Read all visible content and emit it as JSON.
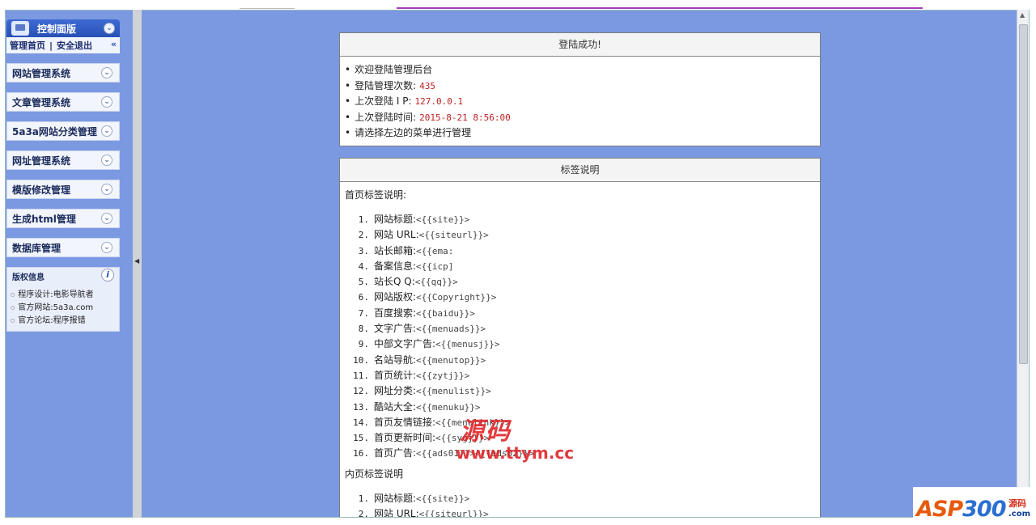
{
  "sidebar": {
    "panel_title": "控制面版",
    "home_link": "管理首页",
    "separator": "|",
    "logout_link": "安全退出",
    "collapse_glyph": "«",
    "menu_items": [
      {
        "label": "网站管理系统"
      },
      {
        "label": "文章管理系统"
      },
      {
        "label": "5a3a网站分类管理"
      },
      {
        "label": "网址管理系统"
      },
      {
        "label": "模版修改管理"
      },
      {
        "label": "生成html管理"
      },
      {
        "label": "数据库管理"
      }
    ],
    "copyright": {
      "title": "版权信息",
      "items": [
        "程序设计:电影导航者",
        "官方网站:5a3a.com",
        "官方论坛:程序报错"
      ]
    }
  },
  "login_box": {
    "title": "登陆成功!",
    "items": [
      {
        "label": "欢迎登陆管理后台",
        "value": ""
      },
      {
        "label": "登陆管理次数:",
        "value": "435"
      },
      {
        "label": "上次登陆 I P:",
        "value": "127.0.0.1"
      },
      {
        "label": "上次登陆时间:",
        "value": "2015-8-21 8:56:00"
      },
      {
        "label": "请选择左边的菜单进行管理",
        "value": ""
      }
    ]
  },
  "tags_box": {
    "title": "标签说明",
    "home_title": "首页标签说明:",
    "home_tags": [
      {
        "num": "1.",
        "label": "网站标题:",
        "code": "<{{site}}>"
      },
      {
        "num": "2.",
        "label": "网站 URL:",
        "code": "<{{siteurl}}>"
      },
      {
        "num": "3.",
        "label": "站长邮箱:",
        "code": "<{{ema:"
      },
      {
        "num": "4.",
        "label": "备案信息:",
        "code": "<{{icp]"
      },
      {
        "num": "5.",
        "label": "站长Q Q:",
        "code": "<{{qq}}>"
      },
      {
        "num": "6.",
        "label": "网站版权:",
        "code": "<{{Copyright}}>"
      },
      {
        "num": "7.",
        "label": "百度搜索:",
        "code": "<{{baidu}}>"
      },
      {
        "num": "8.",
        "label": "文字广告:",
        "code": "<{{menuads}}>"
      },
      {
        "num": "9.",
        "label": "中部文字广告:",
        "code": "<{{menusj}}>"
      },
      {
        "num": "10.",
        "label": "名站导航:",
        "code": "<{{menutop}}>"
      },
      {
        "num": "11.",
        "label": "首页统计:",
        "code": "<{{zytj}}>"
      },
      {
        "num": "12.",
        "label": "网址分类:",
        "code": "<{{menulist}}>"
      },
      {
        "num": "13.",
        "label": "酷站大全:",
        "code": "<{{menuku}}>"
      },
      {
        "num": "14.",
        "label": "首页友情链接:",
        "code": "<{{menulink}}>"
      },
      {
        "num": "15.",
        "label": "首页更新时间:",
        "code": "<{{sygj}}>"
      },
      {
        "num": "16.",
        "label": "首页广告:",
        "code": "<{{ads01}}><{{ads02}}>"
      }
    ],
    "inner_title": "内页标签说明",
    "inner_tags": [
      {
        "num": "1.",
        "label": "网站标题:",
        "code": "<{{site}}>"
      },
      {
        "num": "2.",
        "label": "网站 URL:",
        "code": "<{{siteurl}}>"
      }
    ]
  },
  "watermark": {
    "line1": "源码",
    "line2": "www.ttym.cc"
  },
  "corner_logo": {
    "asp": "ASP",
    "num": "300",
    "cn": "源码",
    "com": ".com"
  },
  "colors": {
    "frame_bg": "#7b99e1",
    "accent_red": "#c02020",
    "purple_line": "#a23fb3"
  }
}
